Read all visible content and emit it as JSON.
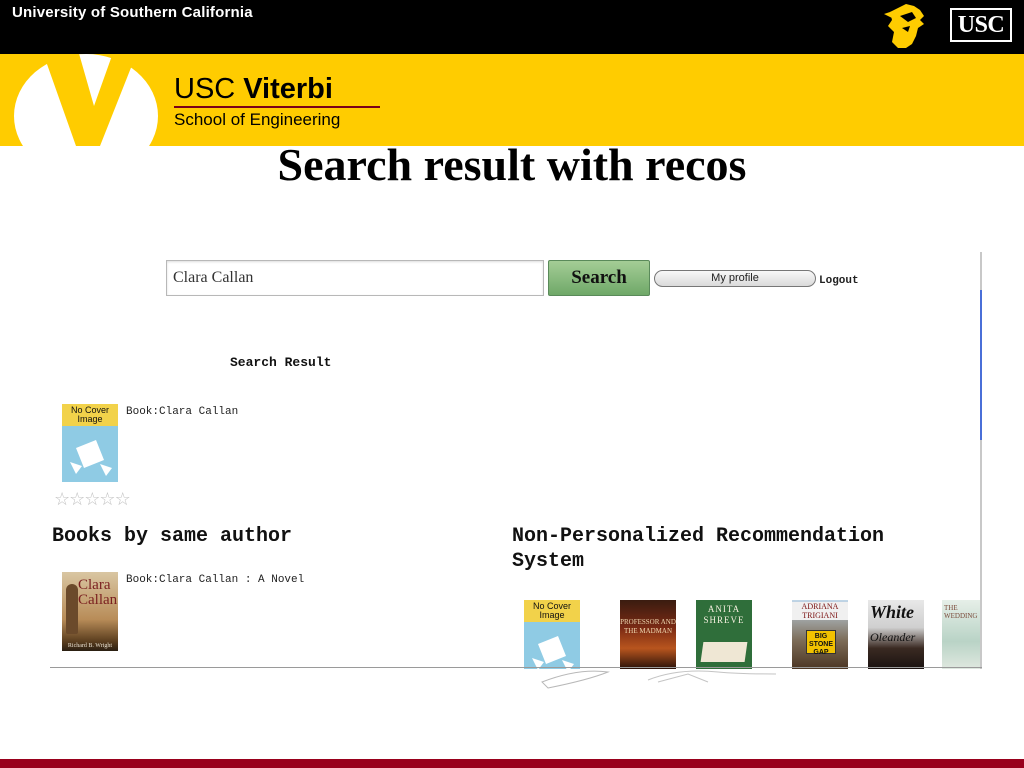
{
  "header": {
    "university": "University of Southern California",
    "usc_logo": "USC",
    "trojan_icon": "trojan-head-icon"
  },
  "branding": {
    "usc": "USC",
    "viterbi": "Viterbi",
    "school": "School of Engineering",
    "gold": "#FFCC00",
    "cardinal": "#99001C"
  },
  "slide": {
    "title": "Search result with recos"
  },
  "app": {
    "search": {
      "value": "Clara Callan",
      "button_label": "Search"
    },
    "profile_button_label": "My profile",
    "logout_label": "Logout",
    "search_result": {
      "heading": "Search Result",
      "book_label": "Book:Clara Callan",
      "cover_text": "No Cover Image",
      "rating_stars": 0,
      "rating_max": 5
    },
    "books_by_same_author": {
      "title": "Books by same author",
      "items": [
        {
          "label": "Book:Clara Callan : A Novel",
          "cover_title": "Clara Callan",
          "cover_author": "Richard B. Wright"
        }
      ]
    },
    "non_personalized": {
      "title_line1": "Non-Personalized Recommendation",
      "title_line2": "System",
      "covers": [
        {
          "text": "No Cover Image"
        },
        {
          "text": "PROFESSOR AND THE MADMAN"
        },
        {
          "text": "ANITA SHREVE"
        },
        {
          "text": "ADRIANA TRIGIANI",
          "sign": "BIG STONE GAP"
        },
        {
          "text": "White",
          "text2": "Oleander"
        },
        {
          "text": "THE WEDDING"
        }
      ]
    }
  }
}
